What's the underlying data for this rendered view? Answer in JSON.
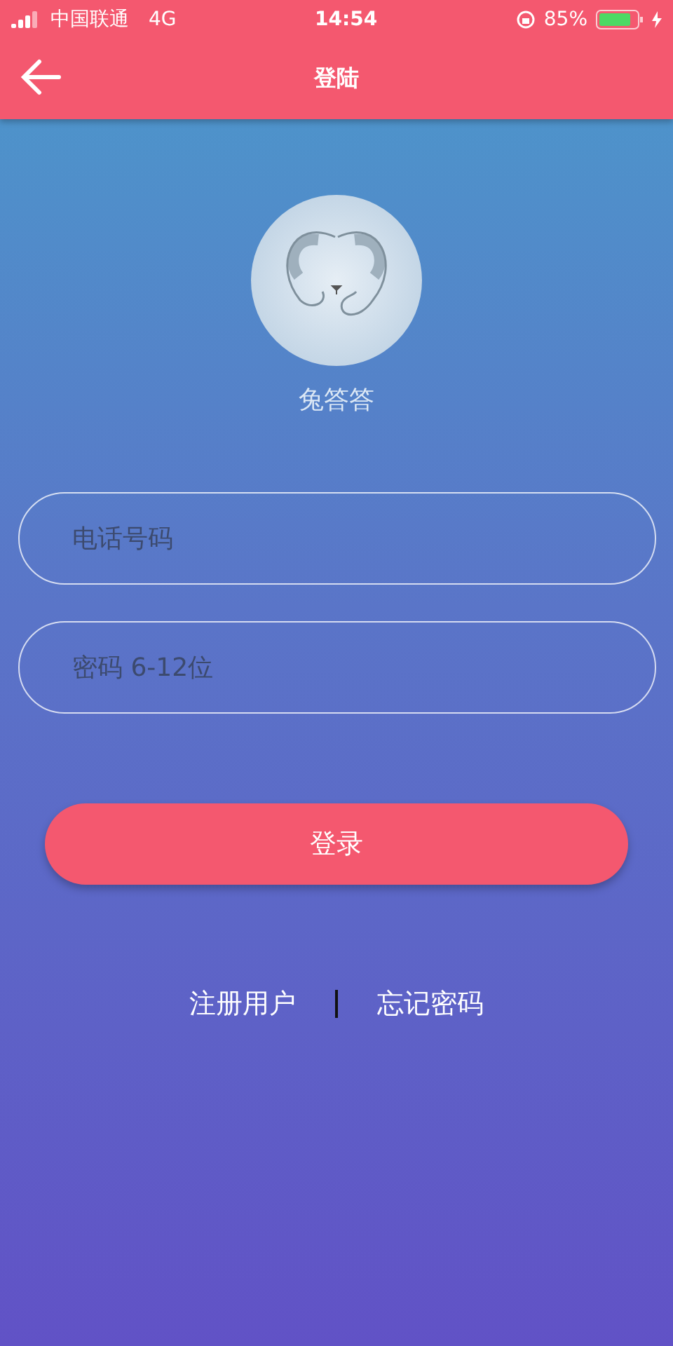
{
  "status_bar": {
    "carrier": "中国联通",
    "network": "4G",
    "time": "14:54",
    "battery": "85%"
  },
  "header": {
    "title": "登陆"
  },
  "app": {
    "name": "兔答答"
  },
  "fields": [
    {
      "placeholder": "电话号码"
    },
    {
      "placeholder": "密码 6-12位"
    }
  ],
  "login_button": "登录",
  "links": [
    "注册用户",
    "忘记密码"
  ]
}
